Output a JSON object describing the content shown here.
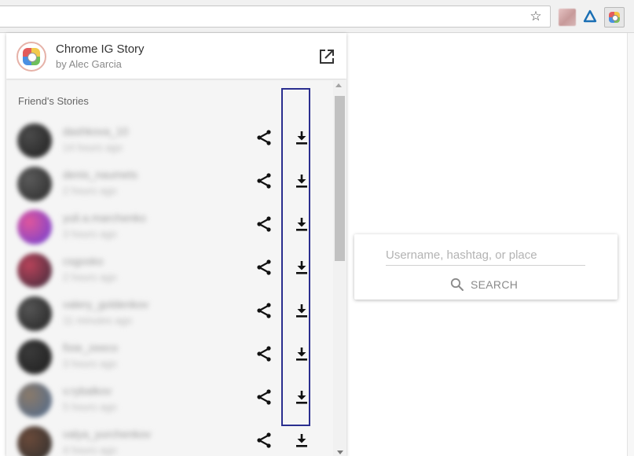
{
  "browser": {
    "bookmark_icon": "☆"
  },
  "popup": {
    "app_name": "Chrome IG Story",
    "author": "by Alec Garcia",
    "section_title": "Friend's Stories"
  },
  "stories": [
    {
      "username": "dashkova_10",
      "time": "14 hours ago",
      "avatar_colors": [
        "#4b4b4b",
        "#1f1f1f"
      ]
    },
    {
      "username": "denis_naumets",
      "time": "2 hours ago",
      "avatar_colors": [
        "#5a5a5a",
        "#2a2a2a"
      ]
    },
    {
      "username": "yuli.a.marchenko",
      "time": "3 hours ago",
      "avatar_colors": [
        "#e0569b",
        "#6a3fd6"
      ]
    },
    {
      "username": "csgosko",
      "time": "2 hours ago",
      "avatar_colors": [
        "#b8435a",
        "#3a2a3a"
      ]
    },
    {
      "username": "valery_goldenkov",
      "time": "11 minutes ago",
      "avatar_colors": [
        "#555555",
        "#222222"
      ]
    },
    {
      "username": "fixie_zeeco",
      "time": "3 hours ago",
      "avatar_colors": [
        "#3a3a3a",
        "#1e1e1e"
      ]
    },
    {
      "username": "v.rybalkov",
      "time": "5 hours ago",
      "avatar_colors": [
        "#8a7a6a",
        "#4e6a8e"
      ]
    },
    {
      "username": "valya_yurchenkov",
      "time": "4 hours ago",
      "avatar_colors": [
        "#6a4a3a",
        "#2e2e2e"
      ]
    }
  ],
  "search": {
    "placeholder": "Username, hashtag, or place",
    "button_label": "SEARCH"
  }
}
